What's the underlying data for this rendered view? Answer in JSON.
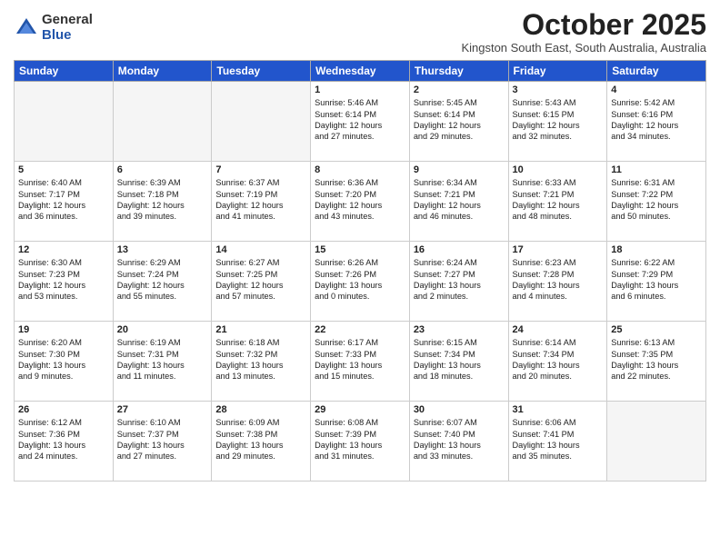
{
  "logo": {
    "general": "General",
    "blue": "Blue"
  },
  "header": {
    "month": "October 2025",
    "location": "Kingston South East, South Australia, Australia"
  },
  "weekdays": [
    "Sunday",
    "Monday",
    "Tuesday",
    "Wednesday",
    "Thursday",
    "Friday",
    "Saturday"
  ],
  "weeks": [
    [
      {
        "day": "",
        "text": ""
      },
      {
        "day": "",
        "text": ""
      },
      {
        "day": "",
        "text": ""
      },
      {
        "day": "1",
        "text": "Sunrise: 5:46 AM\nSunset: 6:14 PM\nDaylight: 12 hours\nand 27 minutes."
      },
      {
        "day": "2",
        "text": "Sunrise: 5:45 AM\nSunset: 6:14 PM\nDaylight: 12 hours\nand 29 minutes."
      },
      {
        "day": "3",
        "text": "Sunrise: 5:43 AM\nSunset: 6:15 PM\nDaylight: 12 hours\nand 32 minutes."
      },
      {
        "day": "4",
        "text": "Sunrise: 5:42 AM\nSunset: 6:16 PM\nDaylight: 12 hours\nand 34 minutes."
      }
    ],
    [
      {
        "day": "5",
        "text": "Sunrise: 6:40 AM\nSunset: 7:17 PM\nDaylight: 12 hours\nand 36 minutes."
      },
      {
        "day": "6",
        "text": "Sunrise: 6:39 AM\nSunset: 7:18 PM\nDaylight: 12 hours\nand 39 minutes."
      },
      {
        "day": "7",
        "text": "Sunrise: 6:37 AM\nSunset: 7:19 PM\nDaylight: 12 hours\nand 41 minutes."
      },
      {
        "day": "8",
        "text": "Sunrise: 6:36 AM\nSunset: 7:20 PM\nDaylight: 12 hours\nand 43 minutes."
      },
      {
        "day": "9",
        "text": "Sunrise: 6:34 AM\nSunset: 7:21 PM\nDaylight: 12 hours\nand 46 minutes."
      },
      {
        "day": "10",
        "text": "Sunrise: 6:33 AM\nSunset: 7:21 PM\nDaylight: 12 hours\nand 48 minutes."
      },
      {
        "day": "11",
        "text": "Sunrise: 6:31 AM\nSunset: 7:22 PM\nDaylight: 12 hours\nand 50 minutes."
      }
    ],
    [
      {
        "day": "12",
        "text": "Sunrise: 6:30 AM\nSunset: 7:23 PM\nDaylight: 12 hours\nand 53 minutes."
      },
      {
        "day": "13",
        "text": "Sunrise: 6:29 AM\nSunset: 7:24 PM\nDaylight: 12 hours\nand 55 minutes."
      },
      {
        "day": "14",
        "text": "Sunrise: 6:27 AM\nSunset: 7:25 PM\nDaylight: 12 hours\nand 57 minutes."
      },
      {
        "day": "15",
        "text": "Sunrise: 6:26 AM\nSunset: 7:26 PM\nDaylight: 13 hours\nand 0 minutes."
      },
      {
        "day": "16",
        "text": "Sunrise: 6:24 AM\nSunset: 7:27 PM\nDaylight: 13 hours\nand 2 minutes."
      },
      {
        "day": "17",
        "text": "Sunrise: 6:23 AM\nSunset: 7:28 PM\nDaylight: 13 hours\nand 4 minutes."
      },
      {
        "day": "18",
        "text": "Sunrise: 6:22 AM\nSunset: 7:29 PM\nDaylight: 13 hours\nand 6 minutes."
      }
    ],
    [
      {
        "day": "19",
        "text": "Sunrise: 6:20 AM\nSunset: 7:30 PM\nDaylight: 13 hours\nand 9 minutes."
      },
      {
        "day": "20",
        "text": "Sunrise: 6:19 AM\nSunset: 7:31 PM\nDaylight: 13 hours\nand 11 minutes."
      },
      {
        "day": "21",
        "text": "Sunrise: 6:18 AM\nSunset: 7:32 PM\nDaylight: 13 hours\nand 13 minutes."
      },
      {
        "day": "22",
        "text": "Sunrise: 6:17 AM\nSunset: 7:33 PM\nDaylight: 13 hours\nand 15 minutes."
      },
      {
        "day": "23",
        "text": "Sunrise: 6:15 AM\nSunset: 7:34 PM\nDaylight: 13 hours\nand 18 minutes."
      },
      {
        "day": "24",
        "text": "Sunrise: 6:14 AM\nSunset: 7:34 PM\nDaylight: 13 hours\nand 20 minutes."
      },
      {
        "day": "25",
        "text": "Sunrise: 6:13 AM\nSunset: 7:35 PM\nDaylight: 13 hours\nand 22 minutes."
      }
    ],
    [
      {
        "day": "26",
        "text": "Sunrise: 6:12 AM\nSunset: 7:36 PM\nDaylight: 13 hours\nand 24 minutes."
      },
      {
        "day": "27",
        "text": "Sunrise: 6:10 AM\nSunset: 7:37 PM\nDaylight: 13 hours\nand 27 minutes."
      },
      {
        "day": "28",
        "text": "Sunrise: 6:09 AM\nSunset: 7:38 PM\nDaylight: 13 hours\nand 29 minutes."
      },
      {
        "day": "29",
        "text": "Sunrise: 6:08 AM\nSunset: 7:39 PM\nDaylight: 13 hours\nand 31 minutes."
      },
      {
        "day": "30",
        "text": "Sunrise: 6:07 AM\nSunset: 7:40 PM\nDaylight: 13 hours\nand 33 minutes."
      },
      {
        "day": "31",
        "text": "Sunrise: 6:06 AM\nSunset: 7:41 PM\nDaylight: 13 hours\nand 35 minutes."
      },
      {
        "day": "",
        "text": ""
      }
    ]
  ]
}
